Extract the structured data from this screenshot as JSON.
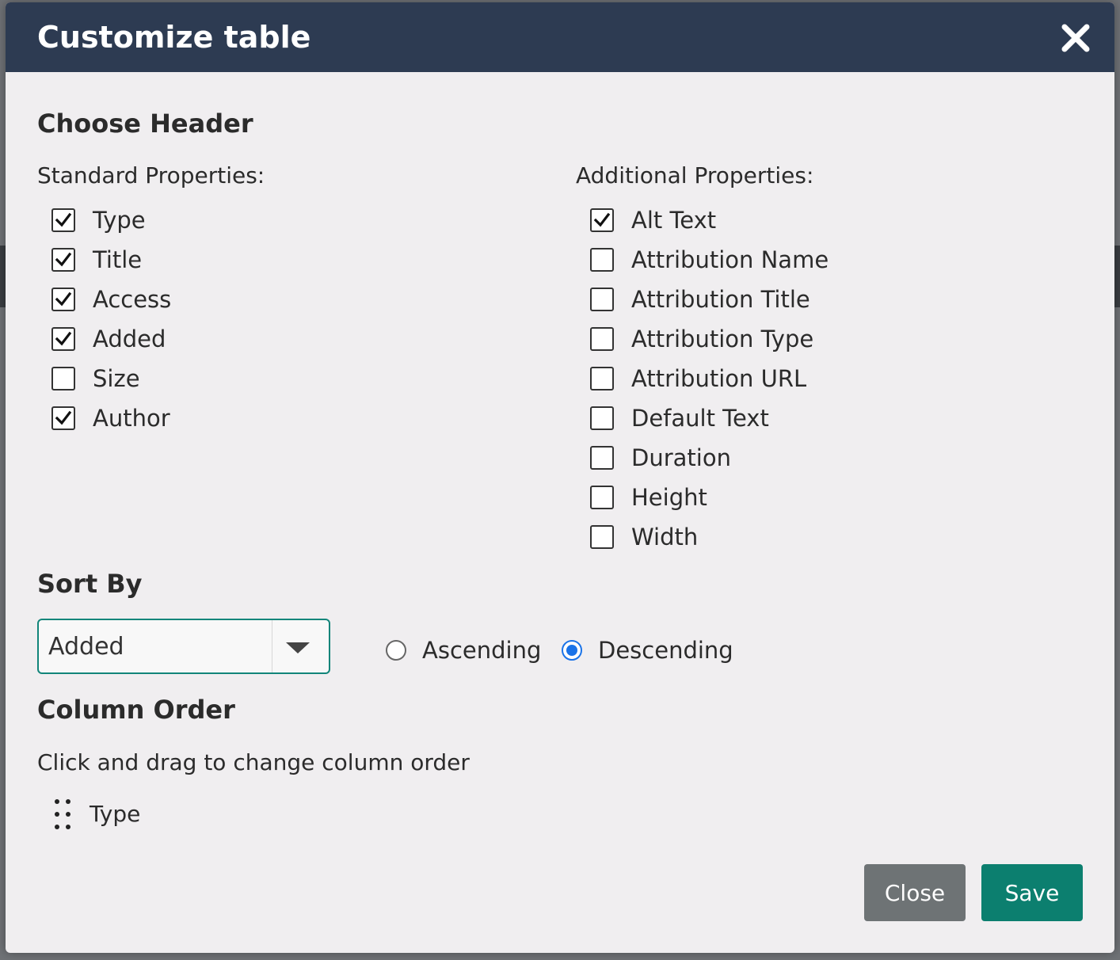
{
  "modal": {
    "title": "Customize table"
  },
  "choose_header": {
    "heading": "Choose Header",
    "standard_label": "Standard Properties:",
    "standard": [
      {
        "label": "Type",
        "checked": true
      },
      {
        "label": "Title",
        "checked": true
      },
      {
        "label": "Access",
        "checked": true
      },
      {
        "label": "Added",
        "checked": true
      },
      {
        "label": "Size",
        "checked": false
      },
      {
        "label": "Author",
        "checked": true
      }
    ],
    "additional_label": "Additional Properties:",
    "additional": [
      {
        "label": "Alt Text",
        "checked": true
      },
      {
        "label": "Attribution Name",
        "checked": false
      },
      {
        "label": "Attribution Title",
        "checked": false
      },
      {
        "label": "Attribution Type",
        "checked": false
      },
      {
        "label": "Attribution URL",
        "checked": false
      },
      {
        "label": "Default Text",
        "checked": false
      },
      {
        "label": "Duration",
        "checked": false
      },
      {
        "label": "Height",
        "checked": false
      },
      {
        "label": "Width",
        "checked": false
      }
    ]
  },
  "sort_by": {
    "heading": "Sort By",
    "selected": "Added",
    "ascending_label": "Ascending",
    "descending_label": "Descending",
    "direction": "descending"
  },
  "column_order": {
    "heading": "Column Order",
    "help": "Click and drag to change column order",
    "items": [
      "Type"
    ]
  },
  "footer": {
    "close_label": "Close",
    "save_label": "Save"
  },
  "colors": {
    "header_bg": "#2d3b52",
    "accent": "#0c7f6f",
    "radio_accent": "#1a73e8",
    "close_button": "#6e7375"
  }
}
